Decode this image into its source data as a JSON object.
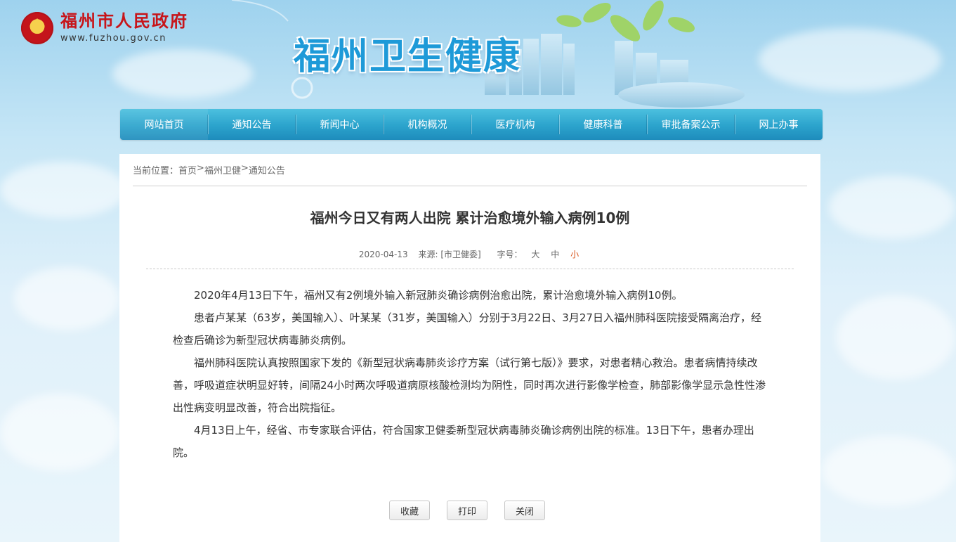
{
  "header": {
    "gov_name": "福州市人民政府",
    "gov_url": "www.fuzhou.gov.cn",
    "site_title": "福州卫生健康",
    "emblem_icon": "national-emblem-icon"
  },
  "nav": {
    "items": [
      {
        "label": "网站首页"
      },
      {
        "label": "通知公告"
      },
      {
        "label": "新闻中心"
      },
      {
        "label": "机构概况"
      },
      {
        "label": "医疗机构"
      },
      {
        "label": "健康科普"
      },
      {
        "label": "审批备案公示"
      },
      {
        "label": "网上办事"
      }
    ],
    "active_index": 0
  },
  "breadcrumb": {
    "prefix": "当前位置：",
    "items": [
      "首页",
      "福州卫健",
      "通知公告"
    ],
    "separator": ">"
  },
  "article": {
    "title": "福州今日又有两人出院 累计治愈境外输入病例10例",
    "date": "2020-04-13",
    "source": "来源: [市卫健委]",
    "font_size_label": "字号：",
    "font_sizes": [
      "大",
      "中",
      "小"
    ],
    "selected_font_size": "小",
    "paragraphs": [
      "2020年4月13日下午，福州又有2例境外输入新冠肺炎确诊病例治愈出院，累计治愈境外输入病例10例。",
      "患者卢某某（63岁，美国输入）、叶某某（31岁，美国输入）分别于3月22日、3月27日入福州肺科医院接受隔离治疗，经检查后确诊为新型冠状病毒肺炎病例。",
      "福州肺科医院认真按照国家下发的《新型冠状病毒肺炎诊疗方案（试行第七版）》要求，对患者精心救治。患者病情持续改善，呼吸道症状明显好转，间隔24小时两次呼吸道病原核酸检测均为阴性，同时再次进行影像学检查，肺部影像学显示急性性渗出性病变明显改善，符合出院指征。",
      "4月13日上午，经省、市专家联合评估，符合国家卫健委新型冠状病毒肺炎确诊病例出院的标准。13日下午，患者办理出院。"
    ]
  },
  "actions": {
    "favorite": "收藏",
    "print": "打印",
    "close": "关闭"
  },
  "colors": {
    "nav": "#2ba3cc",
    "gov_red": "#c7151a",
    "title_blue": "#1e9ad8",
    "small_active": "#d9541b"
  }
}
